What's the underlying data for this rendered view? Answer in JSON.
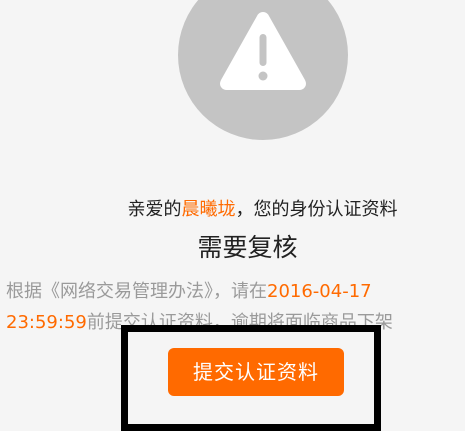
{
  "warning": {
    "icon": "warning-triangle-icon",
    "circle_color": "#c4c4c4"
  },
  "greeting": {
    "prefix": "亲爱的",
    "name": "晨曦垅",
    "suffix": "，您的身份认证资料"
  },
  "headline": "需要复核",
  "notice": {
    "part1": "根据《网络交易管理办法》，请在",
    "deadline_date": "2016-04-17",
    "deadline_time": "23:59:59",
    "part2": "前提交认证资料，逾期将面临商品下架"
  },
  "button": {
    "label": "提交认证资料"
  },
  "colors": {
    "accent": "#ff6a00",
    "background": "#f5f5f5",
    "text": "#222222",
    "muted_text": "#9a9a9a"
  }
}
